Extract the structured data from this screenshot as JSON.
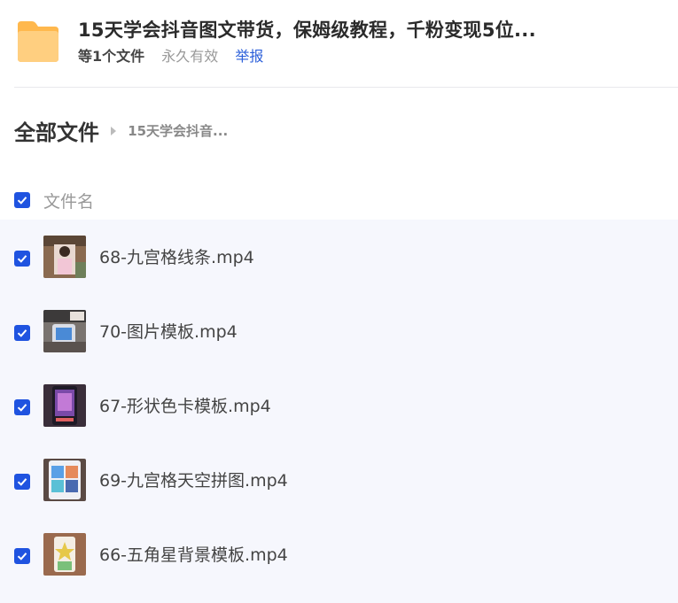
{
  "share": {
    "title": "15天学会抖音图文带货，保姆级教程，千粉变现5位...",
    "file_count": "等1个文件",
    "validity": "永久有效",
    "report": "举报",
    "icon": "folder-icon"
  },
  "breadcrumb": {
    "root": "全部文件",
    "current": "15天学会抖音..."
  },
  "list": {
    "header_label": "文件名",
    "all_checked": true,
    "files": [
      {
        "name": "68-九宫格线条.mp4",
        "checked": true,
        "thumb": "video-thumbnail"
      },
      {
        "name": "70-图片模板.mp4",
        "checked": true,
        "thumb": "video-thumbnail"
      },
      {
        "name": "67-形状色卡模板.mp4",
        "checked": true,
        "thumb": "video-thumbnail"
      },
      {
        "name": "69-九宫格天空拼图.mp4",
        "checked": true,
        "thumb": "video-thumbnail"
      },
      {
        "name": "66-五角星背景模板.mp4",
        "checked": true,
        "thumb": "video-thumbnail"
      }
    ]
  },
  "colors": {
    "accent": "#1f53e0",
    "link": "#2b5fd9",
    "list_bg": "#f6f7fd",
    "folder": "#ffc56e"
  }
}
